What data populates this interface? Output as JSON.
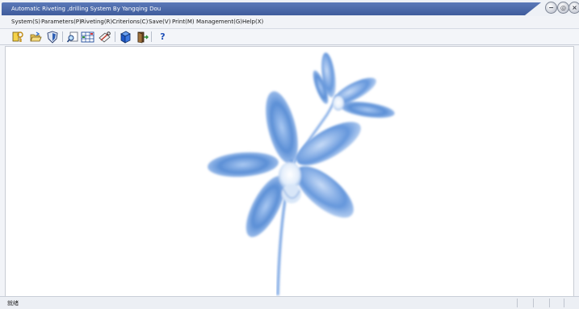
{
  "window": {
    "title": "Automatic Riveting ,drilling System By Yangqing Dou"
  },
  "controls": {
    "minimize": "−",
    "restore": "◎",
    "close": "×"
  },
  "menu": [
    {
      "label": "System(S)"
    },
    {
      "label": "Parameters(P)"
    },
    {
      "label": "Riveting(R)"
    },
    {
      "label": "Criterions(C)"
    },
    {
      "label": "Save(V)"
    },
    {
      "label": "Print(M)"
    },
    {
      "label": "Management(G)"
    },
    {
      "label": "Help(X)"
    }
  ],
  "toolbar": {
    "help_glyph": "?"
  },
  "status": {
    "text": "就绪"
  },
  "colors": {
    "title_bar": "#4a67a8",
    "petal_blue": "#5b8fd6",
    "accent_green": "#2f8f3a"
  }
}
